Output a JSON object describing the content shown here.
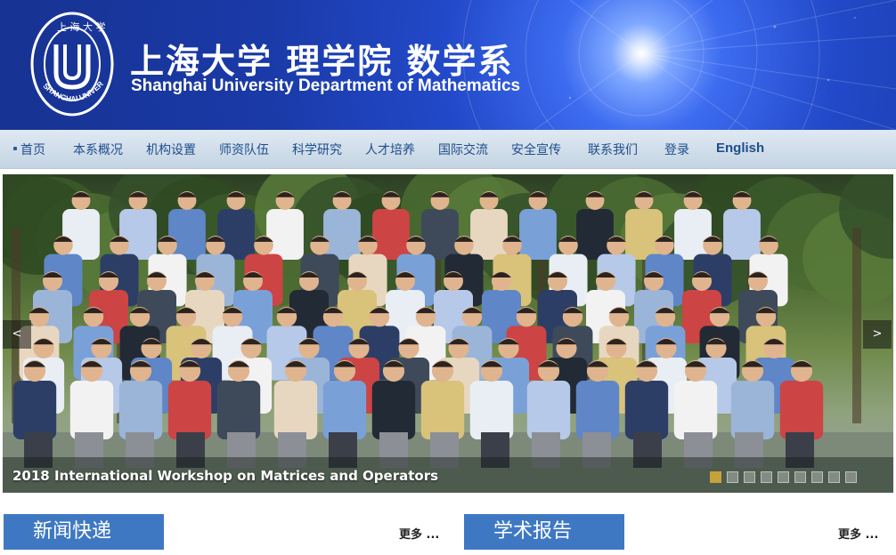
{
  "header": {
    "title_cn": "上海大学 理学院 数学系",
    "title_en": "Shanghai University Department of Mathematics",
    "logo_text": "SHANGHAI UNIVERSITY",
    "logo_icon": "university-seal-icon"
  },
  "nav": {
    "items": [
      {
        "label": "首页"
      },
      {
        "label": "本系概况"
      },
      {
        "label": "机构设置"
      },
      {
        "label": "师资队伍"
      },
      {
        "label": "科学研究"
      },
      {
        "label": "人才培养"
      },
      {
        "label": "国际交流"
      },
      {
        "label": "安全宣传"
      },
      {
        "label": "联系我们"
      },
      {
        "label": "登录"
      },
      {
        "label": "English"
      }
    ]
  },
  "slideshow": {
    "caption": "2018 International Workshop on Matrices and Operators",
    "prev_label": "<",
    "next_label": ">",
    "slide_count": 9,
    "active_index": 0
  },
  "sections": {
    "news": {
      "title": "新闻快递",
      "more_label": "更多 ..."
    },
    "seminars": {
      "title": "学术报告",
      "more_label": "更多 ..."
    }
  },
  "colors": {
    "banner_blue": "#2249c9",
    "nav_text": "#1f4d8c",
    "section_blue": "#3f78c2",
    "active_dot": "#c6a23a"
  }
}
